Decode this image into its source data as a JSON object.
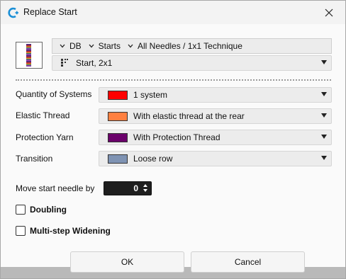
{
  "window": {
    "title": "Replace Start"
  },
  "path": {
    "items": [
      "DB",
      "Starts",
      "All Needles / 1x1 Technique"
    ]
  },
  "start_select": {
    "value": "Start, 2x1"
  },
  "fields": [
    {
      "label": "Quantity of Systems",
      "value": "1 system",
      "color": "#ff0000"
    },
    {
      "label": "Elastic Thread",
      "value": "With elastic thread at the rear",
      "color": "#ff8040"
    },
    {
      "label": "Protection Yarn",
      "value": "With Protection Thread",
      "color": "#6a006a"
    },
    {
      "label": "Transition",
      "value": "Loose row",
      "color": "#7f93b3"
    }
  ],
  "move_start": {
    "label": "Move start needle by",
    "value": "0"
  },
  "checks": [
    {
      "label": "Doubling",
      "checked": false
    },
    {
      "label": "Multi-step Widening",
      "checked": false
    }
  ],
  "buttons": {
    "ok": "OK",
    "cancel": "Cancel"
  }
}
